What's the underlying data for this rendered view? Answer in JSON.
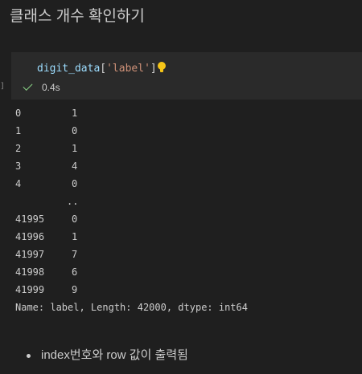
{
  "markdown": {
    "heading": "클래스 개수 확인하기",
    "bullets": [
      "index번호와 row 값이 출력됨"
    ]
  },
  "cell": {
    "code": {
      "variable": "digit_data",
      "open_bracket": "[",
      "key": "'label'",
      "close_bracket": "]"
    },
    "gutter_mark": "]",
    "status": {
      "icon": "check-icon",
      "time": "0.4s"
    }
  },
  "output": {
    "rows_head": [
      {
        "index": "0",
        "value": "1"
      },
      {
        "index": "1",
        "value": "0"
      },
      {
        "index": "2",
        "value": "1"
      },
      {
        "index": "3",
        "value": "4"
      },
      {
        "index": "4",
        "value": "0"
      }
    ],
    "ellipsis": "..",
    "rows_tail": [
      {
        "index": "41995",
        "value": "0"
      },
      {
        "index": "41996",
        "value": "1"
      },
      {
        "index": "41997",
        "value": "7"
      },
      {
        "index": "41998",
        "value": "6"
      },
      {
        "index": "41999",
        "value": "9"
      }
    ],
    "footer": "Name: label, Length: 42000, dtype: int64"
  },
  "colors": {
    "background": "#1f1f1f",
    "cell_background": "#2a2a2a",
    "variable": "#9cdcfe",
    "string": "#ce9178",
    "bulb": "#f5c518",
    "success": "#89d185"
  }
}
